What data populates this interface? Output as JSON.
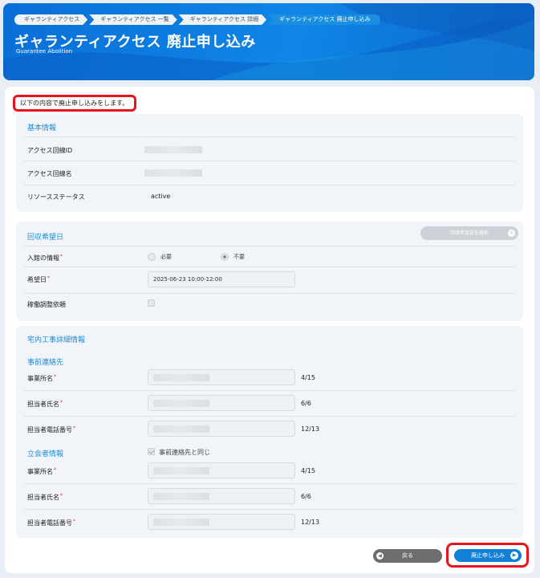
{
  "breadcrumb": [
    "ギャランティアクセス",
    "ギャランティアクセス 一覧",
    "ギャランティアクセス 詳細",
    "ギャランティアクセス 廃止申し込み"
  ],
  "header": {
    "title": "ギャランティアクセス 廃止申し込み",
    "subtitle": "Guarantee Abolition"
  },
  "intro": "以下の内容で廃止申し込みをします。",
  "basic": {
    "title": "基本情報",
    "rows": [
      {
        "label": "アクセス回線ID",
        "value": ""
      },
      {
        "label": "アクセス回線名",
        "value": ""
      },
      {
        "label": "リソースステータス",
        "value": "active"
      }
    ]
  },
  "collection": {
    "title": "回収希望日",
    "select_button": "回収希望日を選択",
    "entry_label": "入館の情報",
    "entry_options": [
      "必要",
      "不要"
    ],
    "entry_selected": "不要",
    "date_label": "希望日",
    "date_value": "2025-06-23  10:00-12:00",
    "adjust_label": "稼働調整依頼",
    "adjust_checked": false
  },
  "work": {
    "title": "宅内工事詳細情報",
    "prior_contact": {
      "title": "事前連絡先",
      "fields": [
        {
          "label": "事業所名",
          "counter": "4/15"
        },
        {
          "label": "担当者氏名",
          "counter": "6/6"
        },
        {
          "label": "担当者電話番号",
          "counter": "12/13"
        }
      ]
    },
    "attendee": {
      "title": "立会者情報",
      "same_as_label": "事前連絡先と同じ",
      "same_as_checked": true,
      "fields": [
        {
          "label": "事業所名",
          "counter": "4/15"
        },
        {
          "label": "担当者氏名",
          "counter": "6/6"
        },
        {
          "label": "担当者電話番号",
          "counter": "12/13"
        }
      ]
    }
  },
  "buttons": {
    "back": "戻る",
    "submit": "廃止申し込み"
  },
  "colors": {
    "accent": "#1280d9",
    "highlight": "#e8141c",
    "header": "#0a6fd8"
  },
  "icons": {
    "back": "chevron-left-icon",
    "submit": "chevron-right-icon",
    "clear": "close-icon"
  }
}
